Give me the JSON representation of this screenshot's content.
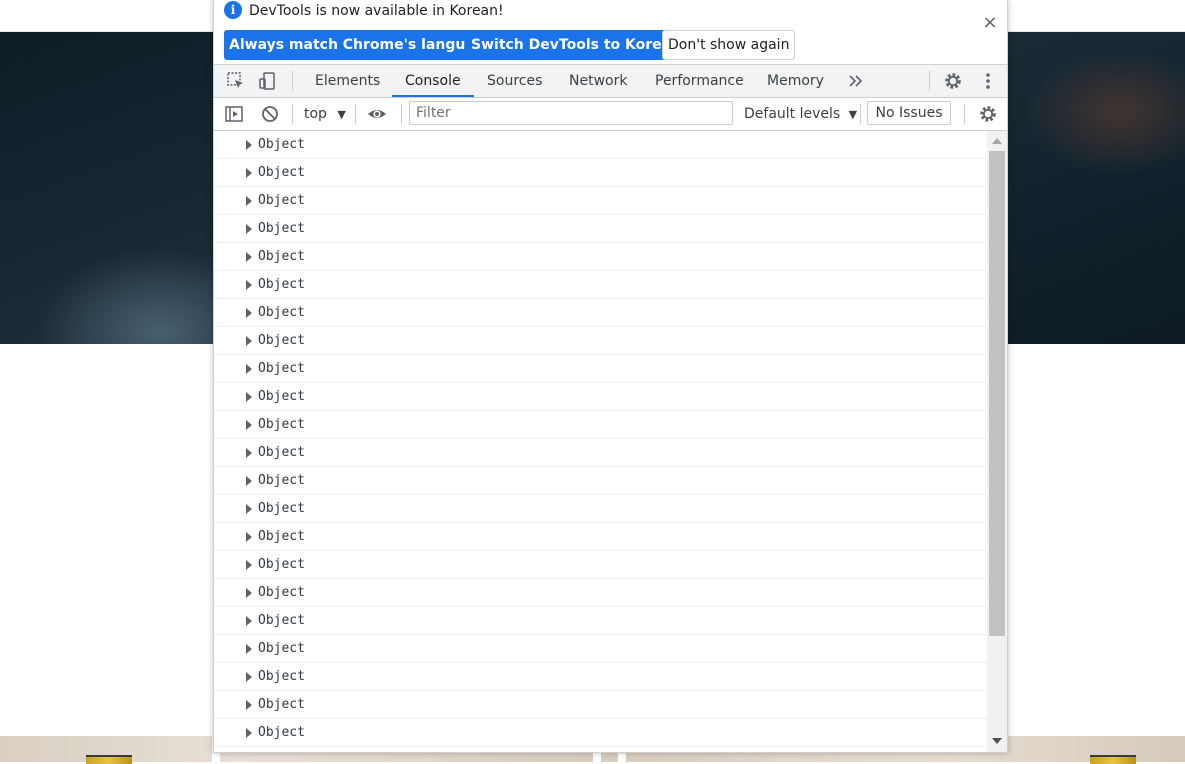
{
  "infobar": {
    "icon": "info-icon",
    "message": "DevTools is now available in Korean!",
    "buttons": {
      "match_language": "Always match Chrome's language",
      "switch_korean": "Switch DevTools to Korean",
      "dont_show": "Don't show again"
    },
    "close_icon": "close-icon"
  },
  "tabs": {
    "items": [
      "Elements",
      "Console",
      "Sources",
      "Network",
      "Performance",
      "Memory"
    ],
    "active": "Console",
    "more_icon": "chevron-double-right-icon",
    "settings_icon": "gear-icon",
    "menu_icon": "kebab-menu-icon",
    "inspect_icon": "inspect-element-icon",
    "device_icon": "device-toolbar-icon"
  },
  "console_toolbar": {
    "sidebar_icon": "show-sidebar-icon",
    "clear_icon": "clear-console-icon",
    "context": "top",
    "eye_icon": "live-expression-eye-icon",
    "filter_placeholder": "Filter",
    "levels": "Default levels",
    "issues": "No Issues",
    "settings_icon": "gear-icon"
  },
  "console_rows": [
    "Object",
    "Object",
    "Object",
    "Object",
    "Object",
    "Object",
    "Object",
    "Object",
    "Object",
    "Object",
    "Object",
    "Object",
    "Object",
    "Object",
    "Object",
    "Object",
    "Object",
    "Object",
    "Object",
    "Object",
    "Object",
    "Object"
  ],
  "colors": {
    "accent": "#1a73e8",
    "toolbar_bg": "#f1f3f4",
    "text": "#202124"
  }
}
